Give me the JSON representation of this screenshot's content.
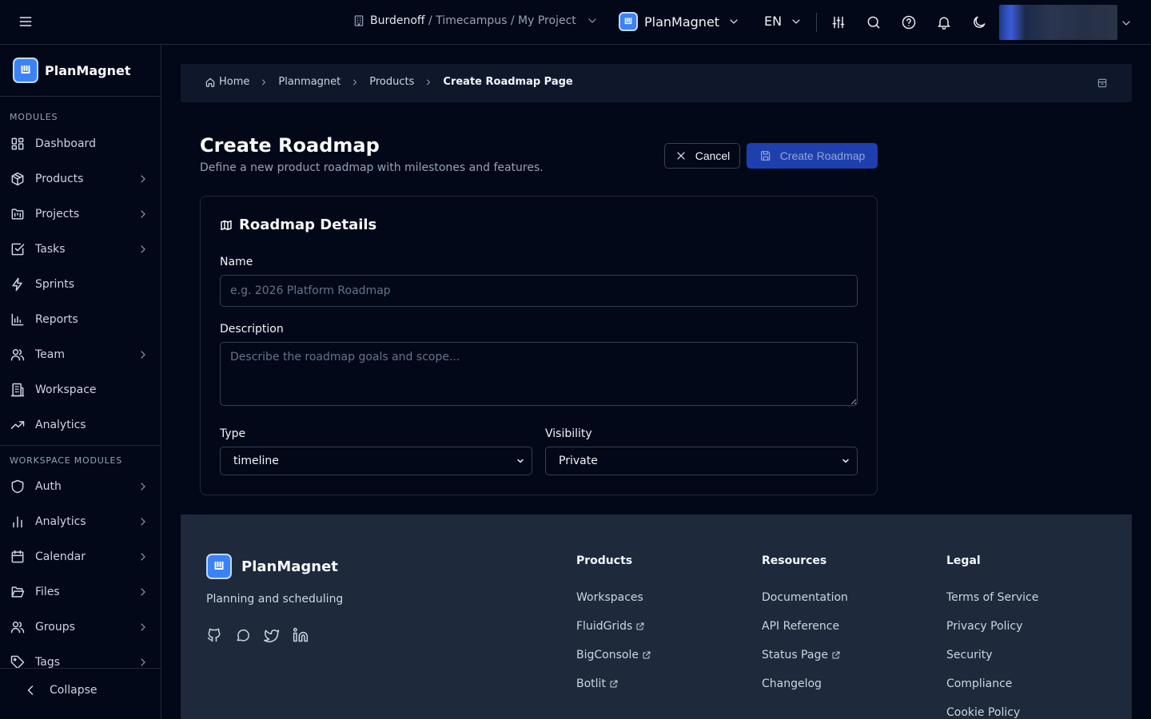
{
  "topbar": {
    "org_name": "Burdenoff",
    "org_path": " / Timecampus / My Project",
    "app_name": "PlanMagnet",
    "language": "EN"
  },
  "sidebar": {
    "brand": "PlanMagnet",
    "modules_heading": "MODULES",
    "modules": [
      {
        "label": "Dashboard",
        "icon": "dashboard-icon",
        "has_children": false
      },
      {
        "label": "Products",
        "icon": "package-icon",
        "has_children": true
      },
      {
        "label": "Projects",
        "icon": "folder-kanban-icon",
        "has_children": true
      },
      {
        "label": "Tasks",
        "icon": "check-square-icon",
        "has_children": true
      },
      {
        "label": "Sprints",
        "icon": "zap-icon",
        "has_children": false
      },
      {
        "label": "Reports",
        "icon": "bar-chart-icon",
        "has_children": false
      },
      {
        "label": "Team",
        "icon": "users-icon",
        "has_children": true
      },
      {
        "label": "Workspace",
        "icon": "building-icon",
        "has_children": false
      },
      {
        "label": "Analytics",
        "icon": "trending-up-icon",
        "has_children": false
      }
    ],
    "workspace_heading": "WORKSPACE MODULES",
    "workspace_modules": [
      {
        "label": "Auth",
        "icon": "shield-icon",
        "has_children": true
      },
      {
        "label": "Analytics",
        "icon": "chart-bars-icon",
        "has_children": true
      },
      {
        "label": "Calendar",
        "icon": "calendar-icon",
        "has_children": true
      },
      {
        "label": "Files",
        "icon": "folder-open-icon",
        "has_children": true
      },
      {
        "label": "Groups",
        "icon": "group-icon",
        "has_children": true
      },
      {
        "label": "Tags",
        "icon": "tag-icon",
        "has_children": true
      }
    ],
    "collapse_label": "Collapse"
  },
  "breadcrumb": {
    "items": [
      "Home",
      "Planmagnet",
      "Products"
    ],
    "current": "Create Roadmap Page"
  },
  "page": {
    "title": "Create Roadmap",
    "subtitle": "Define a new product roadmap with milestones and features.",
    "cancel_label": "Cancel",
    "create_label": "Create Roadmap"
  },
  "form": {
    "section_title": "Roadmap Details",
    "name_label": "Name",
    "name_placeholder": "e.g. 2026 Platform Roadmap",
    "description_label": "Description",
    "description_placeholder": "Describe the roadmap goals and scope...",
    "type_label": "Type",
    "type_value": "timeline",
    "visibility_label": "Visibility",
    "visibility_value": "Private"
  },
  "footer": {
    "brand": "PlanMagnet",
    "tagline": "Planning and scheduling",
    "socials": [
      "github-icon",
      "chat-icon",
      "twitter-icon",
      "linkedin-icon"
    ],
    "columns": [
      {
        "title": "Products",
        "links": [
          {
            "label": "Workspaces",
            "external": false
          },
          {
            "label": "FluidGrids",
            "external": true
          },
          {
            "label": "BigConsole",
            "external": true
          },
          {
            "label": "Botlit",
            "external": true
          }
        ]
      },
      {
        "title": "Resources",
        "links": [
          {
            "label": "Documentation",
            "external": false
          },
          {
            "label": "API Reference",
            "external": false
          },
          {
            "label": "Status Page",
            "external": true
          },
          {
            "label": "Changelog",
            "external": false
          }
        ]
      },
      {
        "title": "Legal",
        "links": [
          {
            "label": "Terms of Service",
            "external": false
          },
          {
            "label": "Privacy Policy",
            "external": false
          },
          {
            "label": "Security",
            "external": false
          },
          {
            "label": "Compliance",
            "external": false
          },
          {
            "label": "Cookie Policy",
            "external": false
          }
        ]
      }
    ]
  },
  "colors": {
    "background": "#020817",
    "accent": "#3b82f6",
    "primary_button": "#1e40af",
    "footer_bg": "#1e293b"
  }
}
